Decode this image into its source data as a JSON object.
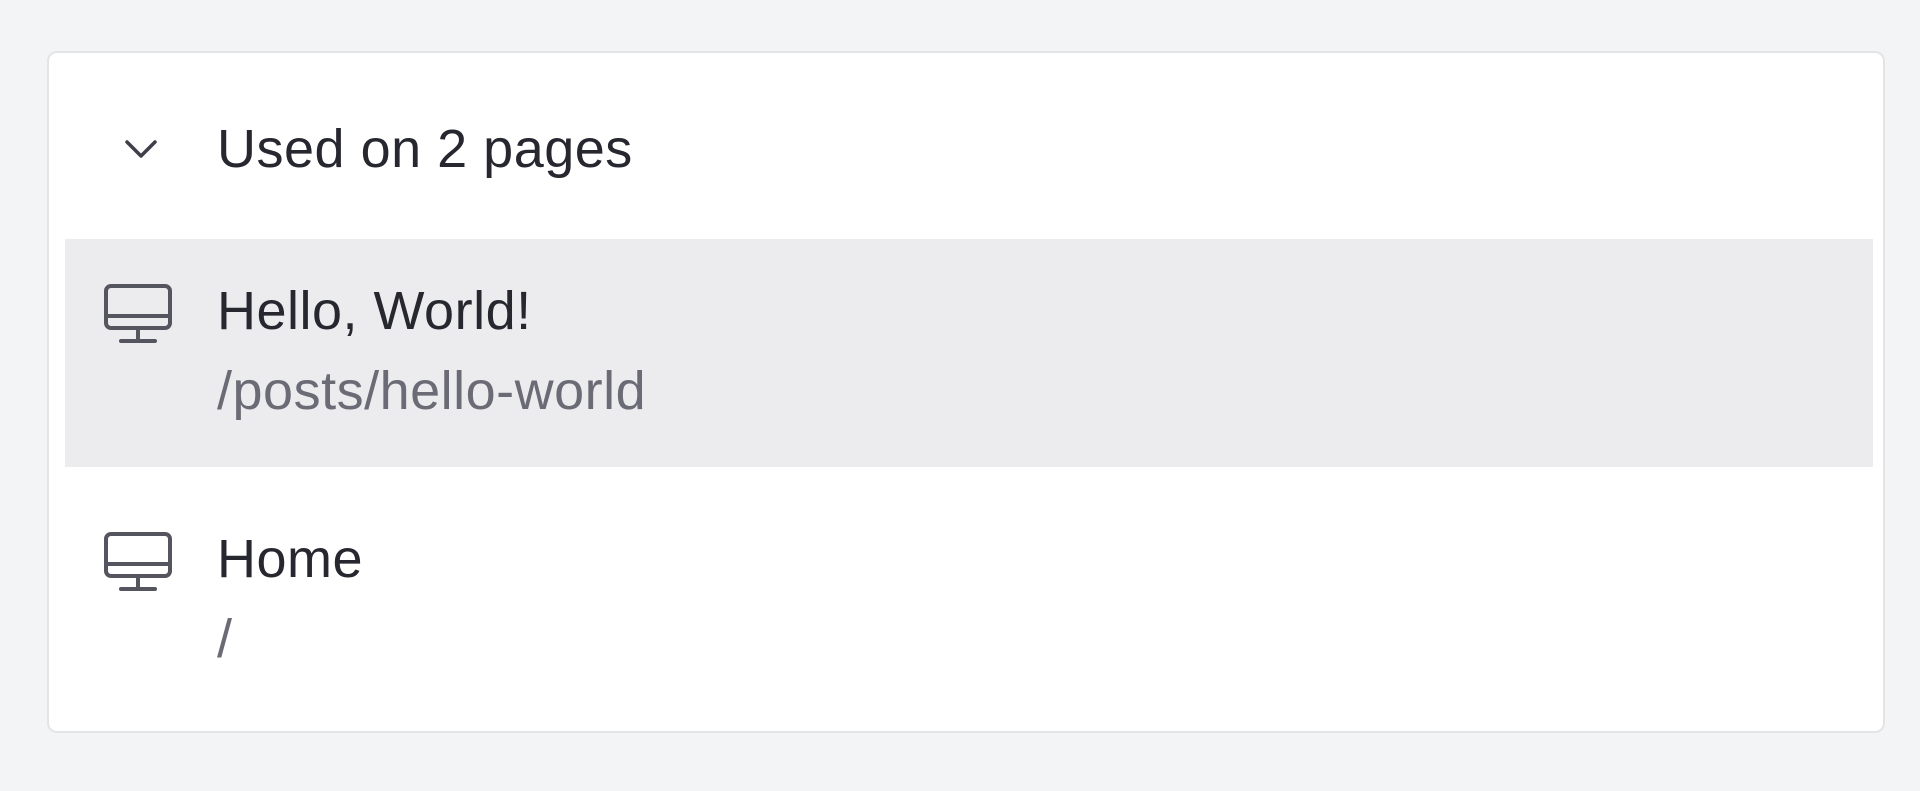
{
  "usage": {
    "header_label": "Used on 2 pages",
    "pages": [
      {
        "title": "Hello, World!",
        "path": "/posts/hello-world",
        "icon": "monitor-icon",
        "highlighted": true
      },
      {
        "title": "Home",
        "path": "/",
        "icon": "monitor-icon",
        "highlighted": false
      }
    ]
  },
  "colors": {
    "card_background": "#ffffff",
    "highlight_background": "#ececef",
    "title_text": "#27272f",
    "path_text": "#6b6b75"
  }
}
